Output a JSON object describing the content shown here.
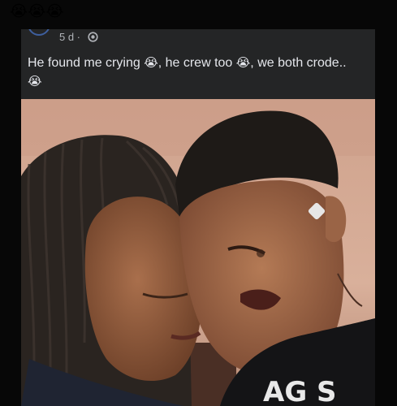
{
  "header": {
    "emojis": "😭😭😭"
  },
  "post": {
    "time": "5 d ·",
    "text_1": "He found me crying ",
    "emoji_1": "😭",
    "text_2": ", he crew too ",
    "emoji_2": "😭",
    "text_3": ", we both crode..",
    "emoji_3": "😭",
    "photo_shirt_text": "AG S"
  },
  "icons": {
    "privacy": "globe-icon"
  },
  "colors": {
    "background": "#070707",
    "card": "#242526",
    "text": "#e4e6eb",
    "meta": "#b0b3b8"
  }
}
